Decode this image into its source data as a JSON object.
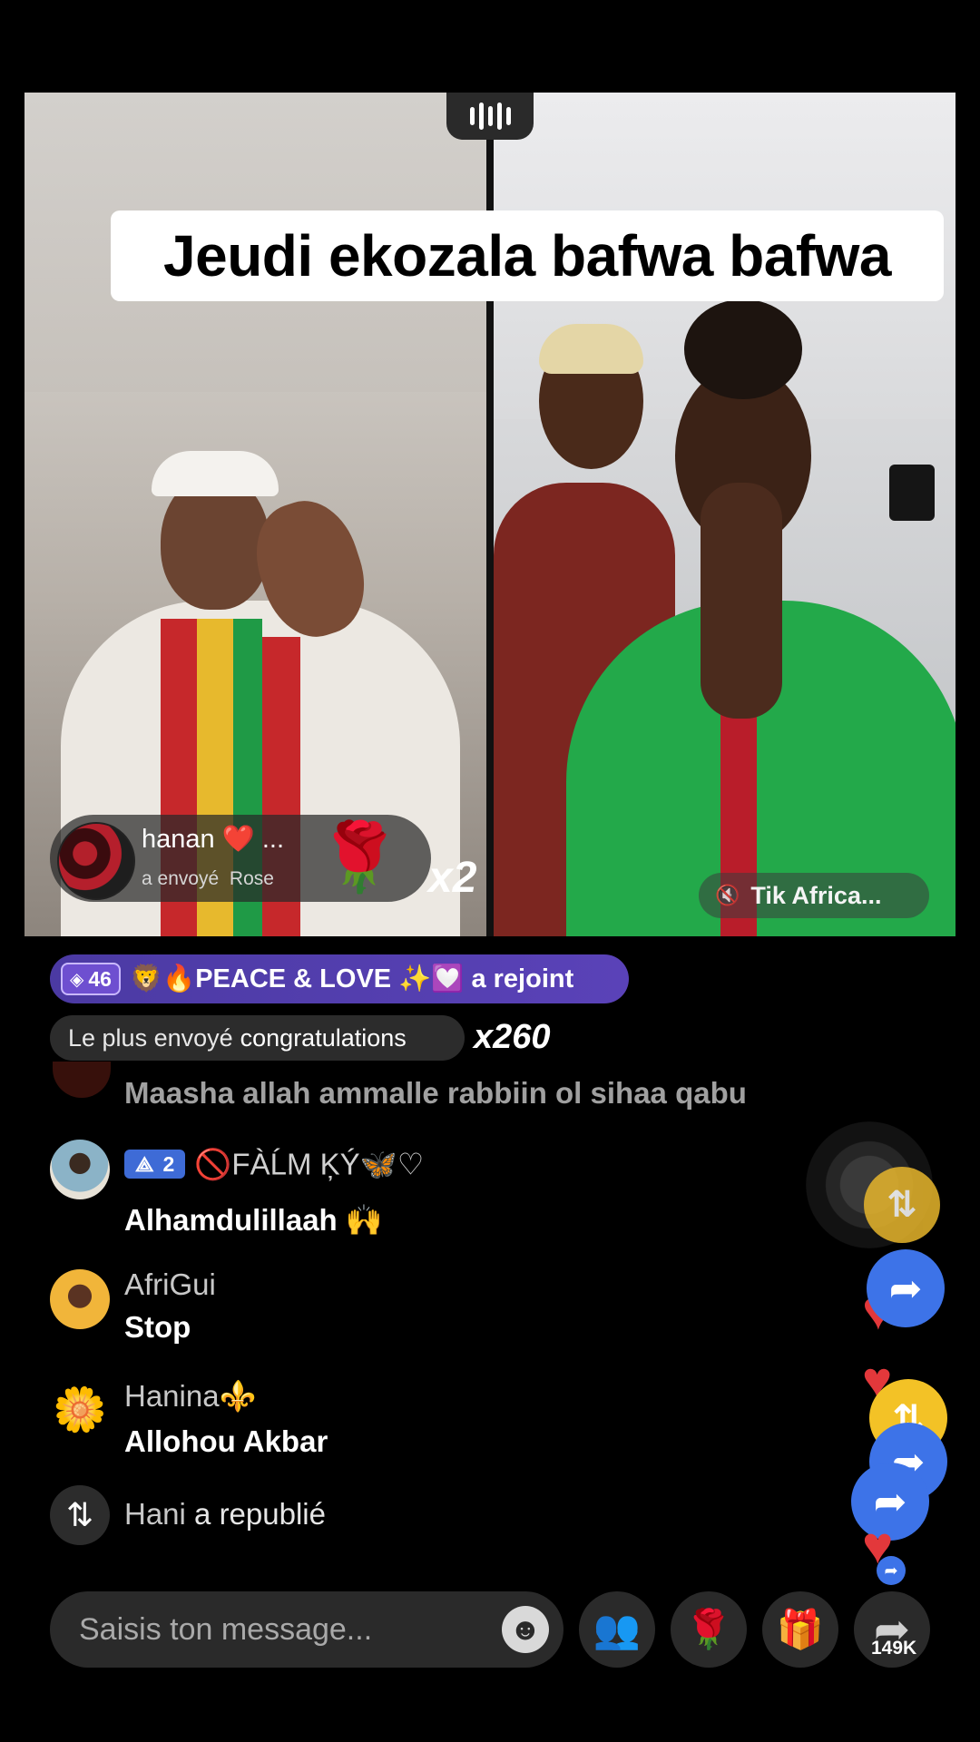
{
  "banner": {
    "title": "Jeudi ekozala bafwa bafwa"
  },
  "gift": {
    "user": "hanan ❤️ ...",
    "action": "a envoyé",
    "item": "Rose",
    "count": "x2",
    "rose_emoji": "🌹"
  },
  "source": {
    "label": "Tik Africa...",
    "muted_icon": "🔇"
  },
  "join": {
    "level": "46",
    "text": "🦁🔥PEACE & LOVE ✨💟 a rejoint"
  },
  "most_sent": {
    "prefix": "Le plus envoyé",
    "item": "congratulations",
    "count": "x260"
  },
  "chat": {
    "faded": "Maasha allah ammalle rabbiin ol sihaa qabu",
    "messages": [
      {
        "rank": "2",
        "name": "🚫FÀĹM ĶÝ🦋♡",
        "text": "Alhamdulillaah 🙌"
      },
      {
        "name": "AfriGui",
        "text": "Stop"
      },
      {
        "name": "Hanina⚜️",
        "text": "Allohou Akbar"
      }
    ],
    "repost": {
      "name": "Hani",
      "action": "a republié"
    }
  },
  "input": {
    "placeholder": "Saisis ton message..."
  },
  "actions": {
    "share_count": "149K"
  },
  "colors": {
    "background": "#000000",
    "join_banner": "#4b3aa3",
    "rank_badge": "#3e6bd6",
    "heart": "#e3383b",
    "share_blue": "#3d73e8",
    "repost_yellow": "#f3c226"
  }
}
